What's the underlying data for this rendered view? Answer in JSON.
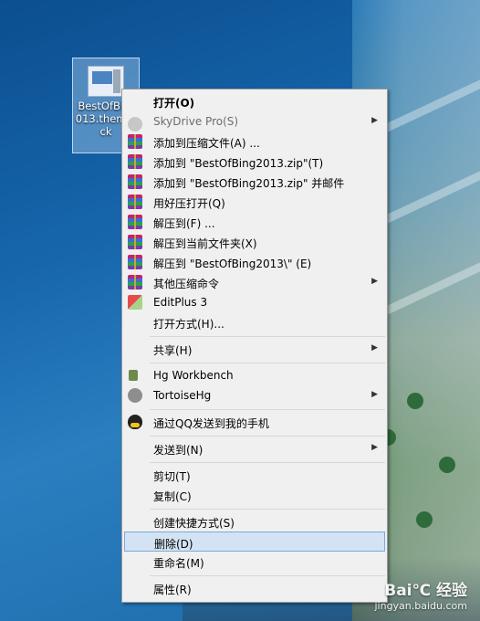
{
  "desktop_icon": {
    "label": "BestOfBing2013.themepack",
    "label_visible": "BestOfBi… 013.them ack"
  },
  "menu": {
    "items": [
      {
        "label": "打开(O)",
        "icon": "open",
        "style": "bold"
      },
      {
        "label": "SkyDrive Pro(S)",
        "icon": "cloud-icon",
        "style": "disabled",
        "submenu": true
      },
      {
        "label": "添加到压缩文件(A) ...",
        "icon": "winrar-icon"
      },
      {
        "label": "添加到 \"BestOfBing2013.zip\"(T)",
        "icon": "winrar-icon"
      },
      {
        "label": "添加到 \"BestOfBing2013.zip\" 并邮件",
        "icon": "winrar-icon"
      },
      {
        "label": "用好压打开(Q)",
        "icon": "winrar-icon"
      },
      {
        "label": "解压到(F) ...",
        "icon": "winrar-icon"
      },
      {
        "label": "解压到当前文件夹(X)",
        "icon": "winrar-icon"
      },
      {
        "label": "解压到 \"BestOfBing2013\\\" (E)",
        "icon": "winrar-icon"
      },
      {
        "label": "其他压缩命令",
        "icon": "winrar-icon",
        "submenu": true
      },
      {
        "label": "EditPlus 3",
        "icon": "editplus-icon"
      },
      {
        "label": "打开方式(H)...",
        "icon": ""
      },
      {
        "label": "共享(H)",
        "icon": "",
        "submenu": true
      },
      {
        "label": "Hg Workbench",
        "icon": "hg-icon"
      },
      {
        "label": "TortoiseHg",
        "icon": "tortoisehg-icon",
        "submenu": true
      },
      {
        "label": "通过QQ发送到我的手机",
        "icon": "qq-icon"
      },
      {
        "label": "发送到(N)",
        "icon": "",
        "submenu": true
      },
      {
        "label": "剪切(T)",
        "icon": ""
      },
      {
        "label": "复制(C)",
        "icon": ""
      },
      {
        "label": "创建快捷方式(S)",
        "icon": ""
      },
      {
        "label": "删除(D)",
        "icon": "",
        "highlighted": true
      },
      {
        "label": "重命名(M)",
        "icon": ""
      },
      {
        "label": "属性(R)",
        "icon": ""
      }
    ]
  },
  "watermark": {
    "brand": "Bai℃ 经验",
    "url": "jingyan.baidu.com"
  },
  "colors": {
    "menu_bg": "#f0f0f0",
    "highlight": "#d3e3f3",
    "highlight_border": "#7aaad9"
  }
}
